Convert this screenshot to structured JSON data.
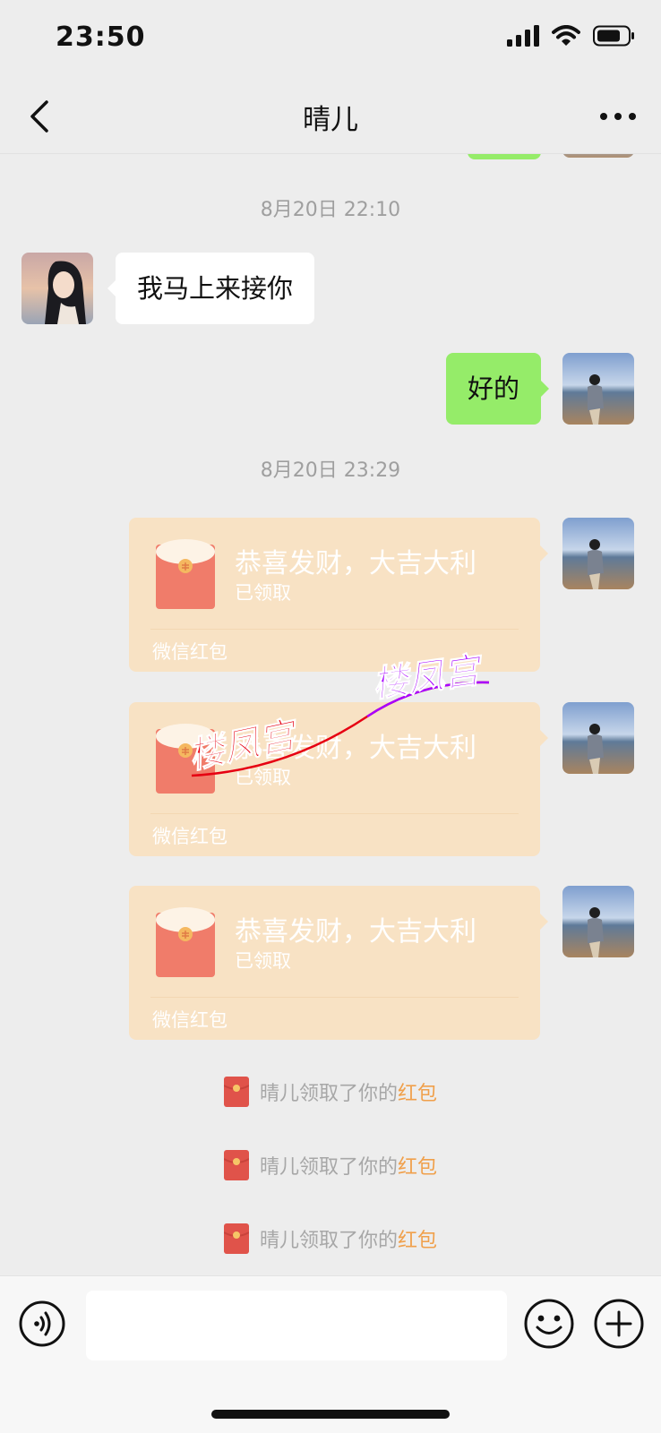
{
  "status_bar": {
    "time": "23:50"
  },
  "nav": {
    "title": "晴儿"
  },
  "timestamps": [
    "8月20日 22:10",
    "8月20日 23:29"
  ],
  "messages": [
    {
      "side": "left",
      "text": "我马上来接你"
    },
    {
      "side": "right",
      "text": "好的"
    }
  ],
  "red_packets": [
    {
      "title": "恭喜发财，大吉大利",
      "status": "已领取",
      "footer": "微信红包"
    },
    {
      "title": "恭喜发财，大吉大利",
      "status": "已领取",
      "footer": "微信红包"
    },
    {
      "title": "恭喜发财，大吉大利",
      "status": "已领取",
      "footer": "微信红包"
    }
  ],
  "system_notes": [
    {
      "text": "晴儿领取了你的",
      "highlight": "红包"
    },
    {
      "text": "晴儿领取了你的",
      "highlight": "红包"
    },
    {
      "text": "晴儿领取了你的",
      "highlight": "红包"
    }
  ],
  "watermarks": [
    "楼凤宫",
    "楼凤宫"
  ],
  "colors": {
    "chat_background": "#ededed",
    "sent_bubble": "#95ec69",
    "received_bubble": "#ffffff",
    "red_packet_received": "#f8e2c4",
    "red_packet_envelope": "#f07c6a",
    "highlight_link": "#f0a04b"
  },
  "icons": {
    "back": "chevron-left-icon",
    "more": "ellipsis-icon",
    "voice": "voice-icon",
    "emoji": "smiley-icon",
    "plus": "plus-icon"
  }
}
